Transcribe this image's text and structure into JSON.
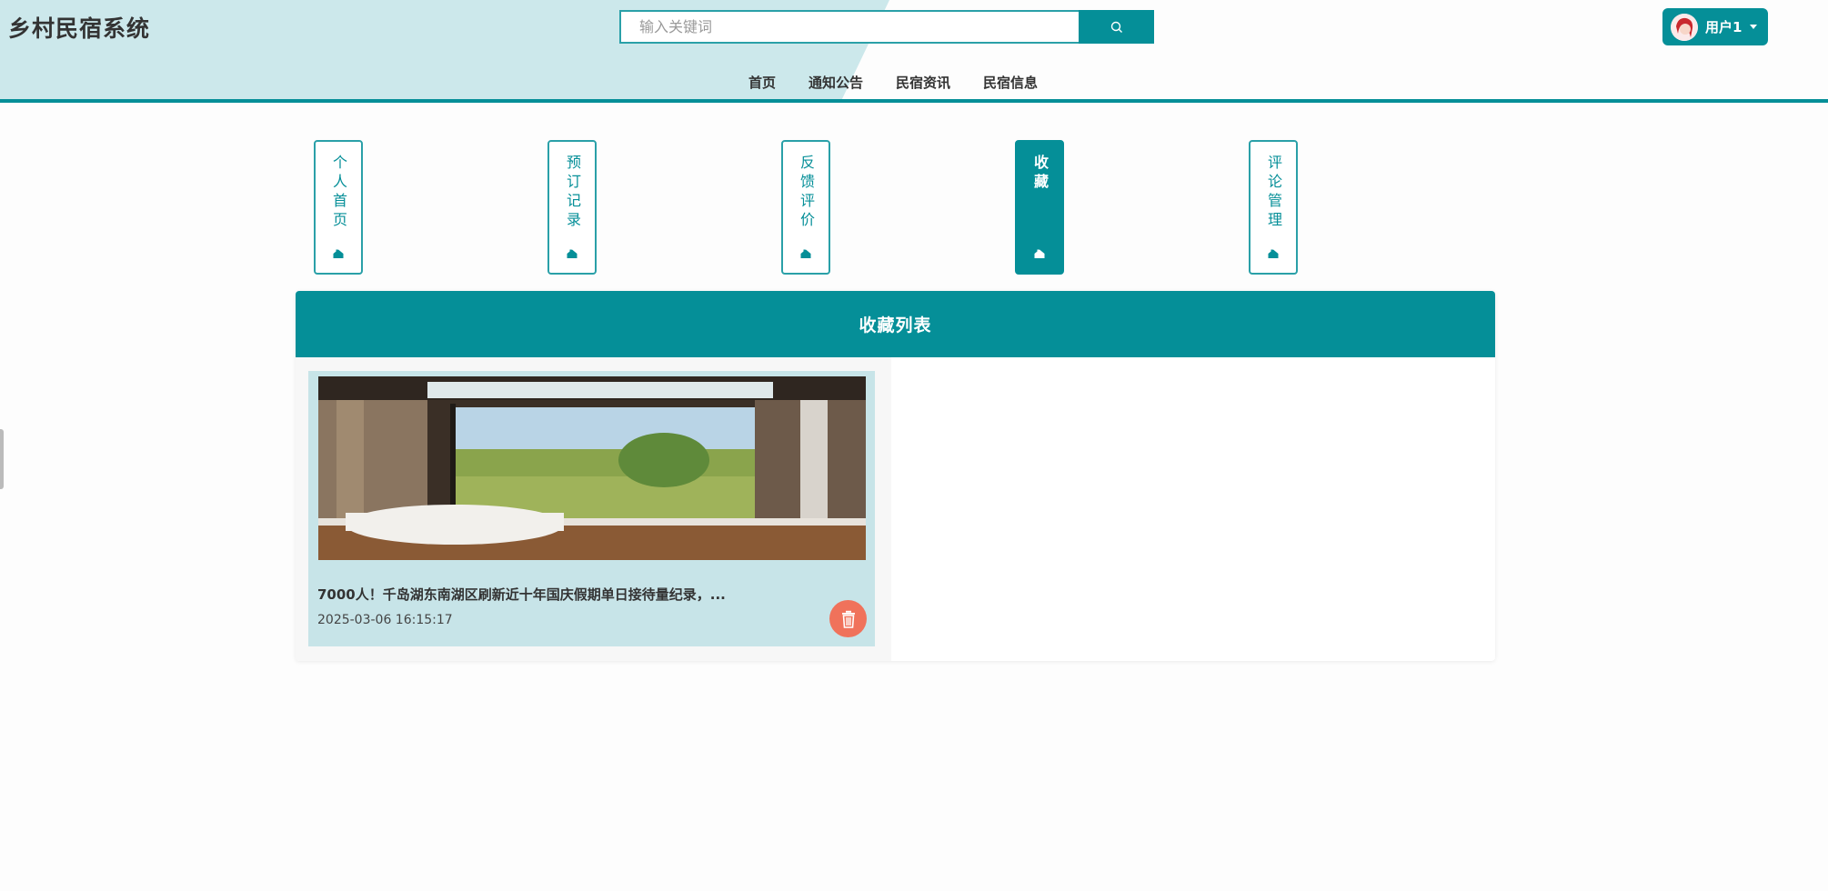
{
  "header": {
    "brand": "乡村民宿系统",
    "search_placeholder": "输入关键词",
    "user_name": "用户1",
    "nav": [
      "首页",
      "通知公告",
      "民宿资讯",
      "民宿信息"
    ]
  },
  "tabs": [
    {
      "label": "个人首页",
      "active": false
    },
    {
      "label": "预订记录",
      "active": false
    },
    {
      "label": "反馈评价",
      "active": false
    },
    {
      "label": "收藏",
      "active": true
    },
    {
      "label": "评论管理",
      "active": false
    }
  ],
  "panel": {
    "title": "收藏列表",
    "items": [
      {
        "title": "7000人！千岛湖东南湖区刷新近十年国庆假期单日接待量纪录，...",
        "time": "2025-03-06 16:15:17"
      }
    ]
  },
  "colors": {
    "accent": "#058f98",
    "card_bg": "#c7e4e8",
    "delete": "#f0725b"
  }
}
